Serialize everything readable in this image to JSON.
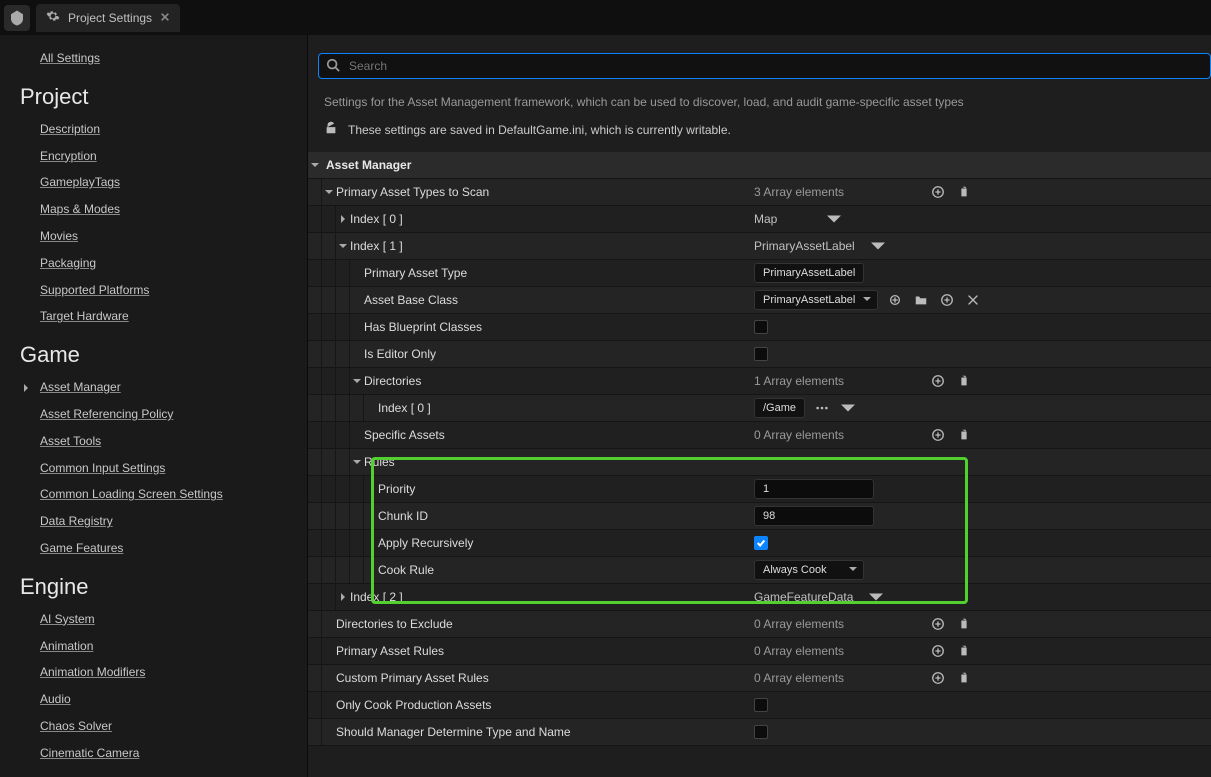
{
  "tab": {
    "title": "Project Settings",
    "close": "×"
  },
  "sidebar": {
    "all": "All Settings",
    "sections": [
      {
        "title": "Project",
        "items": [
          "Description",
          "Encryption",
          "GameplayTags",
          "Maps & Modes",
          "Movies",
          "Packaging",
          "Supported Platforms",
          "Target Hardware"
        ]
      },
      {
        "title": "Game",
        "items": [
          "Asset Manager",
          "Asset Referencing Policy",
          "Asset Tools",
          "Common Input Settings",
          "Common Loading Screen Settings",
          "Data Registry",
          "Game Features"
        ],
        "active_index": 0
      },
      {
        "title": "Engine",
        "items": [
          "AI System",
          "Animation",
          "Animation Modifiers",
          "Audio",
          "Chaos Solver",
          "Cinematic Camera"
        ]
      }
    ]
  },
  "search": {
    "placeholder": "Search"
  },
  "header": {
    "desc": "Settings for the Asset Management framework, which can be used to discover, load, and audit game-specific asset types",
    "save": "These settings are saved in DefaultGame.ini, which is currently writable."
  },
  "cat": {
    "title": "Asset Manager"
  },
  "rows": {
    "scan": {
      "label": "Primary Asset Types to Scan",
      "count": "3 Array elements"
    },
    "i0": {
      "label": "Index [ 0 ]",
      "value": "Map"
    },
    "i1": {
      "label": "Index [ 1 ]",
      "value": "PrimaryAssetLabel"
    },
    "pat": {
      "label": "Primary Asset Type",
      "value": "PrimaryAssetLabel"
    },
    "abc": {
      "label": "Asset Base Class",
      "value": "PrimaryAssetLabel"
    },
    "hbc": {
      "label": "Has Blueprint Classes"
    },
    "ieo": {
      "label": "Is Editor Only"
    },
    "dirs": {
      "label": "Directories",
      "count": "1 Array elements"
    },
    "d0": {
      "label": "Index [ 0 ]",
      "value": "/Game"
    },
    "sa": {
      "label": "Specific Assets",
      "count": "0 Array elements"
    },
    "rules": {
      "label": "Rules"
    },
    "prio": {
      "label": "Priority",
      "value": "1"
    },
    "cid": {
      "label": "Chunk ID",
      "value": "98"
    },
    "ar": {
      "label": "Apply Recursively"
    },
    "cr": {
      "label": "Cook Rule",
      "value": "Always Cook"
    },
    "i2": {
      "label": "Index [ 2 ]",
      "value": "GameFeatureData"
    },
    "dte": {
      "label": "Directories to Exclude",
      "count": "0 Array elements"
    },
    "par": {
      "label": "Primary Asset Rules",
      "count": "0 Array elements"
    },
    "cpar": {
      "label": "Custom Primary Asset Rules",
      "count": "0 Array elements"
    },
    "ocpa": {
      "label": "Only Cook Production Assets"
    },
    "smdtn": {
      "label": "Should Manager Determine Type and Name"
    }
  }
}
